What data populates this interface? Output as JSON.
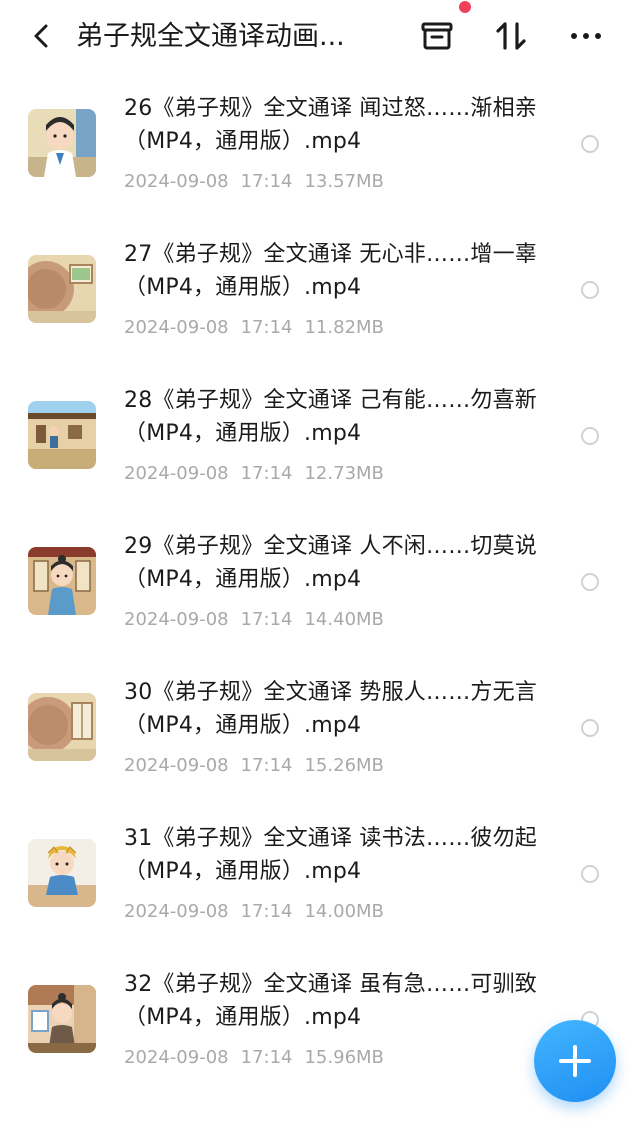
{
  "header": {
    "title": "弟子规全文通译动画...",
    "back_icon": "chevron-left-icon",
    "icons": [
      "archive-box-icon",
      "sort-icon",
      "more-horizontal-icon"
    ],
    "notification_dot_color": "#f0405a"
  },
  "items": [
    {
      "title": "26《弟子规》全文通译 闻过怒……渐相亲（MP4，通用版）.mp4",
      "date": "2024-09-08",
      "time": "17:14",
      "size": "13.57MB"
    },
    {
      "title": "27《弟子规》全文通译 无心非……增一辜（MP4，通用版）.mp4",
      "date": "2024-09-08",
      "time": "17:14",
      "size": "11.82MB"
    },
    {
      "title": "28《弟子规》全文通译 己有能……勿喜新（MP4，通用版）.mp4",
      "date": "2024-09-08",
      "time": "17:14",
      "size": "12.73MB"
    },
    {
      "title": "29《弟子规》全文通译 人不闲……切莫说（MP4，通用版）.mp4",
      "date": "2024-09-08",
      "time": "17:14",
      "size": "14.40MB"
    },
    {
      "title": "30《弟子规》全文通译 势服人……方无言（MP4，通用版）.mp4",
      "date": "2024-09-08",
      "time": "17:14",
      "size": "15.26MB"
    },
    {
      "title": "31《弟子规》全文通译 读书法……彼勿起（MP4，通用版）.mp4",
      "date": "2024-09-08",
      "time": "17:14",
      "size": "14.00MB"
    },
    {
      "title": "32《弟子规》全文通译 虽有急……可驯致（MP4，通用版）.mp4",
      "date": "2024-09-08",
      "time": "17:14",
      "size": "15.96MB"
    }
  ],
  "fab": {
    "icon": "plus-icon",
    "color": "#2a9df5"
  }
}
